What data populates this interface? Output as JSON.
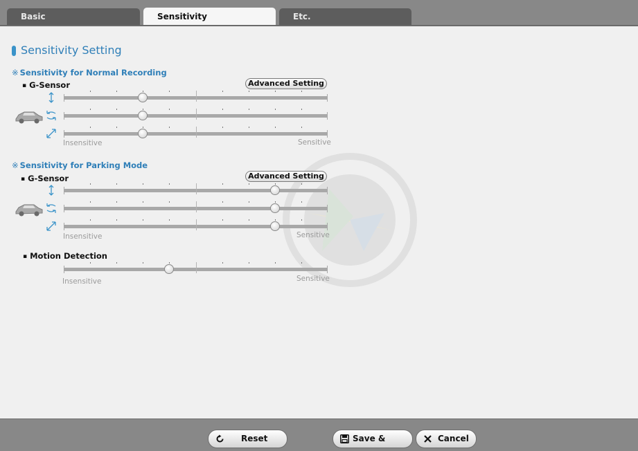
{
  "tabs": [
    {
      "label": "Basic",
      "active": false
    },
    {
      "label": "Sensitivity",
      "active": true
    },
    {
      "label": "Etc.",
      "active": false
    }
  ],
  "page_title": "Sensitivity Setting",
  "normal": {
    "title": "Sensitivity for Normal Recording",
    "mark": "※",
    "sensor_label": "G-Sensor",
    "advanced_label": "Advanced Setting",
    "sliders": [
      {
        "axis": "vertical-axis-icon",
        "level": 3,
        "max": 10
      },
      {
        "axis": "horizontal-axis-icon",
        "level": 6,
        "max": 20
      },
      {
        "axis": "diagonal-axis-icon",
        "level": 6,
        "max": 20
      }
    ],
    "low_label": "Insensitive",
    "high_label": "Sensitive"
  },
  "parking": {
    "title": "Sensitivity for Parking Mode",
    "mark": "※",
    "sensor_label": "G-Sensor",
    "advanced_label": "Advanced Setting",
    "sliders": [
      {
        "axis": "vertical-axis-icon",
        "level": 16,
        "max": 20
      },
      {
        "axis": "horizontal-axis-icon",
        "level": 16,
        "max": 20
      },
      {
        "axis": "diagonal-axis-icon",
        "level": 16,
        "max": 20
      }
    ],
    "low_label": "Insensitive",
    "high_label": "Sensitive"
  },
  "motion": {
    "label": "Motion Detection",
    "level": 4,
    "max": 10,
    "low_label": "Insensitive",
    "high_label": "Sensitive"
  },
  "footer": {
    "reset_label": "Reset",
    "save_label": "Save & Close",
    "cancel_label": "Cancel"
  },
  "colors": {
    "accent": "#2f7fb8",
    "chrome": "#888888",
    "tab_inactive": "#5d5d5d"
  }
}
